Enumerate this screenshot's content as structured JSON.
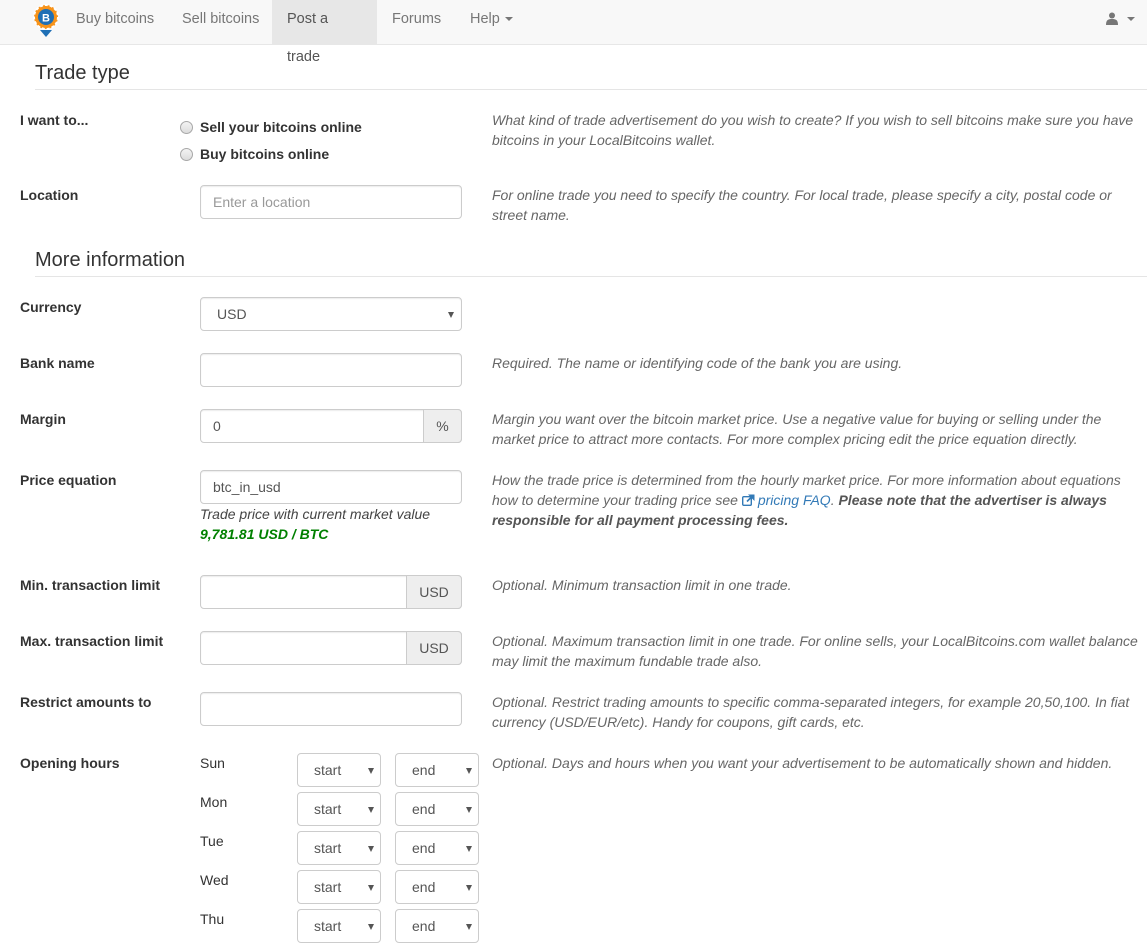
{
  "navbar": {
    "logo": "localbitcoins-logo",
    "items": [
      {
        "label": "Buy bitcoins",
        "active": false
      },
      {
        "label": "Sell bitcoins",
        "active": false
      },
      {
        "label": "Post a trade",
        "active": true
      },
      {
        "label": "Forums",
        "active": false
      },
      {
        "label": "Help",
        "active": false,
        "dropdown": true
      }
    ],
    "user_menu_icon": "user-icon"
  },
  "trade_type": {
    "title": "Trade type",
    "i_want_to": {
      "label": "I want to...",
      "options": [
        "Sell your bitcoins online",
        "Buy bitcoins online"
      ],
      "selected": null,
      "help": "What kind of trade advertisement do you wish to create? If you wish to sell bitcoins make sure you have bitcoins in your LocalBitcoins wallet."
    },
    "location": {
      "label": "Location",
      "placeholder": "Enter a location",
      "value": "",
      "help": "For online trade you need to specify the country. For local trade, please specify a city, postal code or street name."
    }
  },
  "more_info": {
    "title": "More information",
    "currency": {
      "label": "Currency",
      "value": "USD"
    },
    "bank_name": {
      "label": "Bank name",
      "value": "",
      "help": "Required. The name or identifying code of the bank you are using."
    },
    "margin": {
      "label": "Margin",
      "value": "0",
      "addon": "%",
      "help": "Margin you want over the bitcoin market price. Use a negative value for buying or selling under the market price to attract more contacts. For more complex pricing edit the price equation directly."
    },
    "price_equation": {
      "label": "Price equation",
      "value": "btc_in_usd",
      "note": "Trade price with current market value",
      "price": "9,781.81 USD / BTC",
      "price_color": "#008000",
      "help_prefix": "How the trade price is determined from the hourly market price. For more information about equations how to determine your trading price see ",
      "help_link": "pricing FAQ",
      "help_mid": ". ",
      "help_bold": "Please note that the advertiser is always responsible for all payment processing fees."
    },
    "min_limit": {
      "label": "Min. transaction limit",
      "value": "",
      "addon": "USD",
      "help": "Optional. Minimum transaction limit in one trade."
    },
    "max_limit": {
      "label": "Max. transaction limit",
      "value": "",
      "addon": "USD",
      "help": "Optional. Maximum transaction limit in one trade. For online sells, your LocalBitcoins.com wallet balance may limit the maximum fundable trade also."
    },
    "restrict": {
      "label": "Restrict amounts to",
      "value": "",
      "help": "Optional. Restrict trading amounts to specific comma-separated integers, for example 20,50,100. In fiat currency (USD/EUR/etc). Handy for coupons, gift cards, etc."
    },
    "opening_hours": {
      "label": "Opening hours",
      "help": "Optional. Days and hours when you want your advertisement to be automatically shown and hidden.",
      "days": [
        {
          "day": "Sun",
          "start": "start",
          "end": "end"
        },
        {
          "day": "Mon",
          "start": "start",
          "end": "end"
        },
        {
          "day": "Tue",
          "start": "start",
          "end": "end"
        },
        {
          "day": "Wed",
          "start": "start",
          "end": "end"
        },
        {
          "day": "Thu",
          "start": "start",
          "end": "end"
        }
      ]
    }
  }
}
